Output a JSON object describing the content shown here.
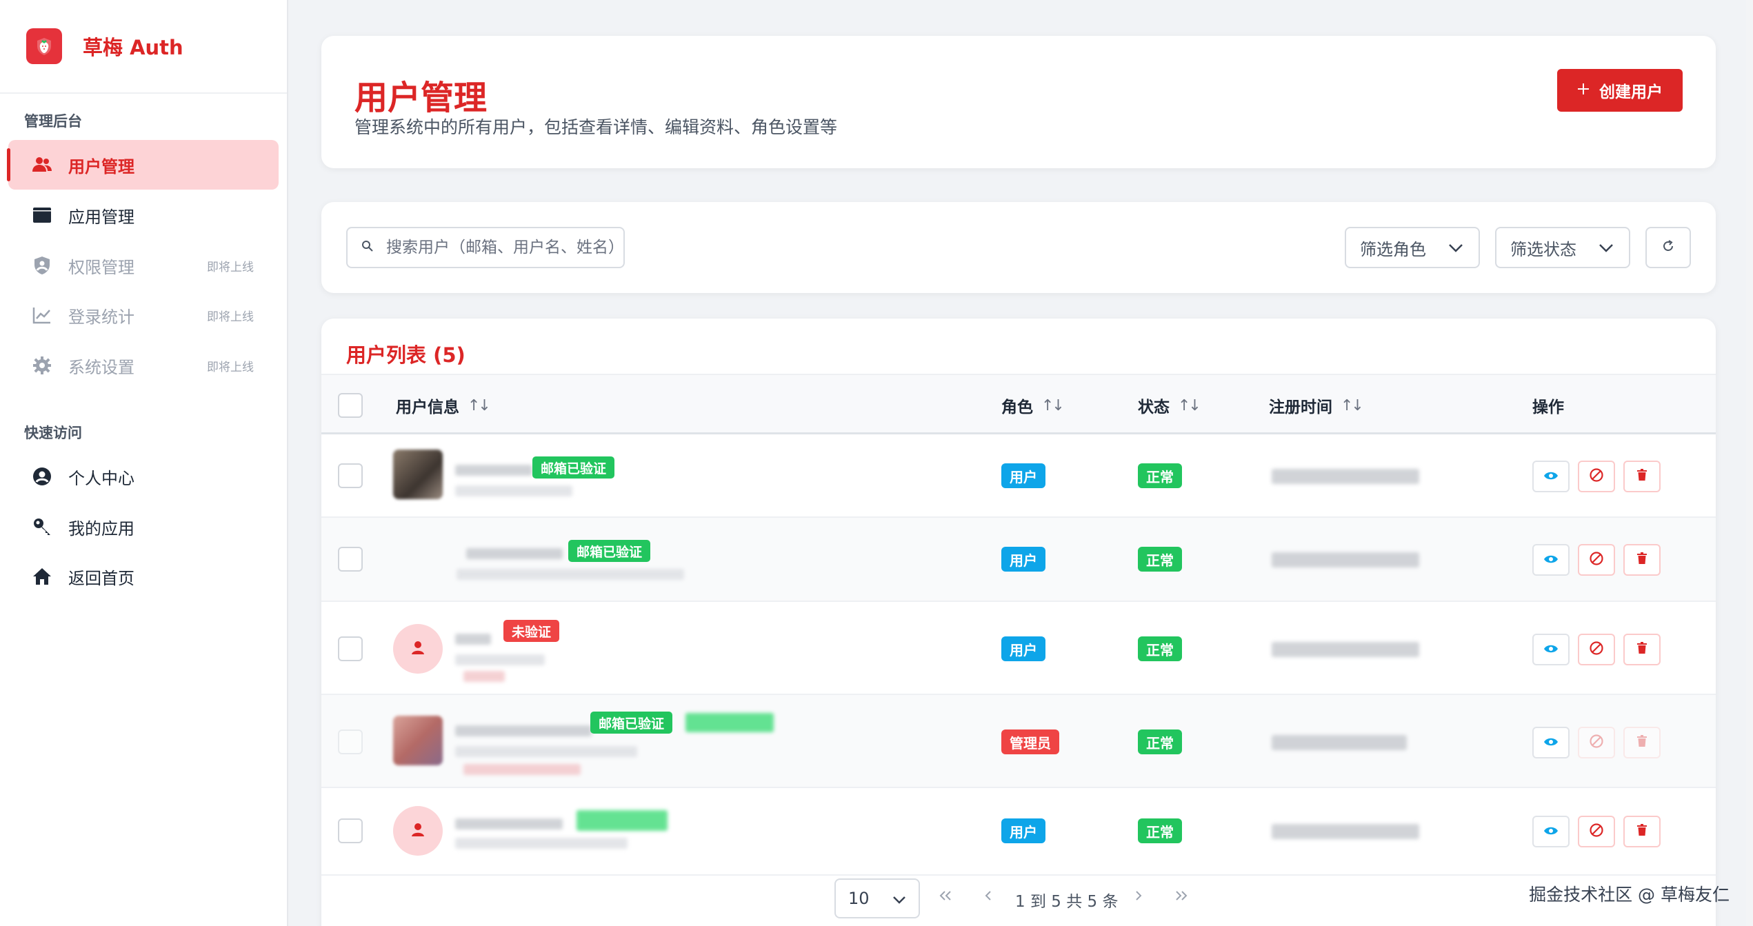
{
  "brand": {
    "name": "草梅 Auth",
    "accent": "#dc2626"
  },
  "sidebar": {
    "section_admin": "管理后台",
    "section_quick": "快速访问",
    "items": [
      {
        "label": "用户管理",
        "icon": "users-icon",
        "active": true
      },
      {
        "label": "应用管理",
        "icon": "window-icon"
      },
      {
        "label": "权限管理",
        "icon": "shield-icon",
        "badge": "即将上线"
      },
      {
        "label": "登录统计",
        "icon": "chart-line-icon",
        "badge": "即将上线"
      },
      {
        "label": "系统设置",
        "icon": "gear-icon",
        "badge": "即将上线"
      }
    ],
    "quick_items": [
      {
        "label": "个人中心",
        "icon": "user-circle-icon"
      },
      {
        "label": "我的应用",
        "icon": "key-icon"
      },
      {
        "label": "返回首页",
        "icon": "home-icon"
      }
    ]
  },
  "header": {
    "title": "用户管理",
    "description": "管理系统中的所有用户，包括查看详情、编辑资料、角色设置等",
    "create_label": "创建用户"
  },
  "filters": {
    "search_placeholder": "搜索用户（邮箱、用户名、姓名）",
    "role_placeholder": "筛选角色",
    "status_placeholder": "筛选状态"
  },
  "table": {
    "title": "用户列表 (5)",
    "columns": [
      "用户信息",
      "角色",
      "状态",
      "注册时间",
      "操作"
    ],
    "rows": [
      {
        "email_badge": "邮箱已验证",
        "role": "用户",
        "status": "正常"
      },
      {
        "email_badge": "邮箱已验证",
        "role": "用户",
        "status": "正常"
      },
      {
        "email_badge": "未验证",
        "role": "用户",
        "status": "正常"
      },
      {
        "email_badge": "邮箱已验证",
        "role": "管理员",
        "status": "正常"
      },
      {
        "email_badge": "",
        "role": "用户",
        "status": "正常"
      }
    ]
  },
  "pagination": {
    "page_size": "10",
    "summary": "1 到 5 共 5 条"
  },
  "watermark": "掘金技术社区 @ 草梅友仁",
  "colors": {
    "primary": "#dc2626",
    "role_user": "#0ea5e9",
    "role_admin": "#ef4444",
    "status_ok": "#22c55e"
  }
}
